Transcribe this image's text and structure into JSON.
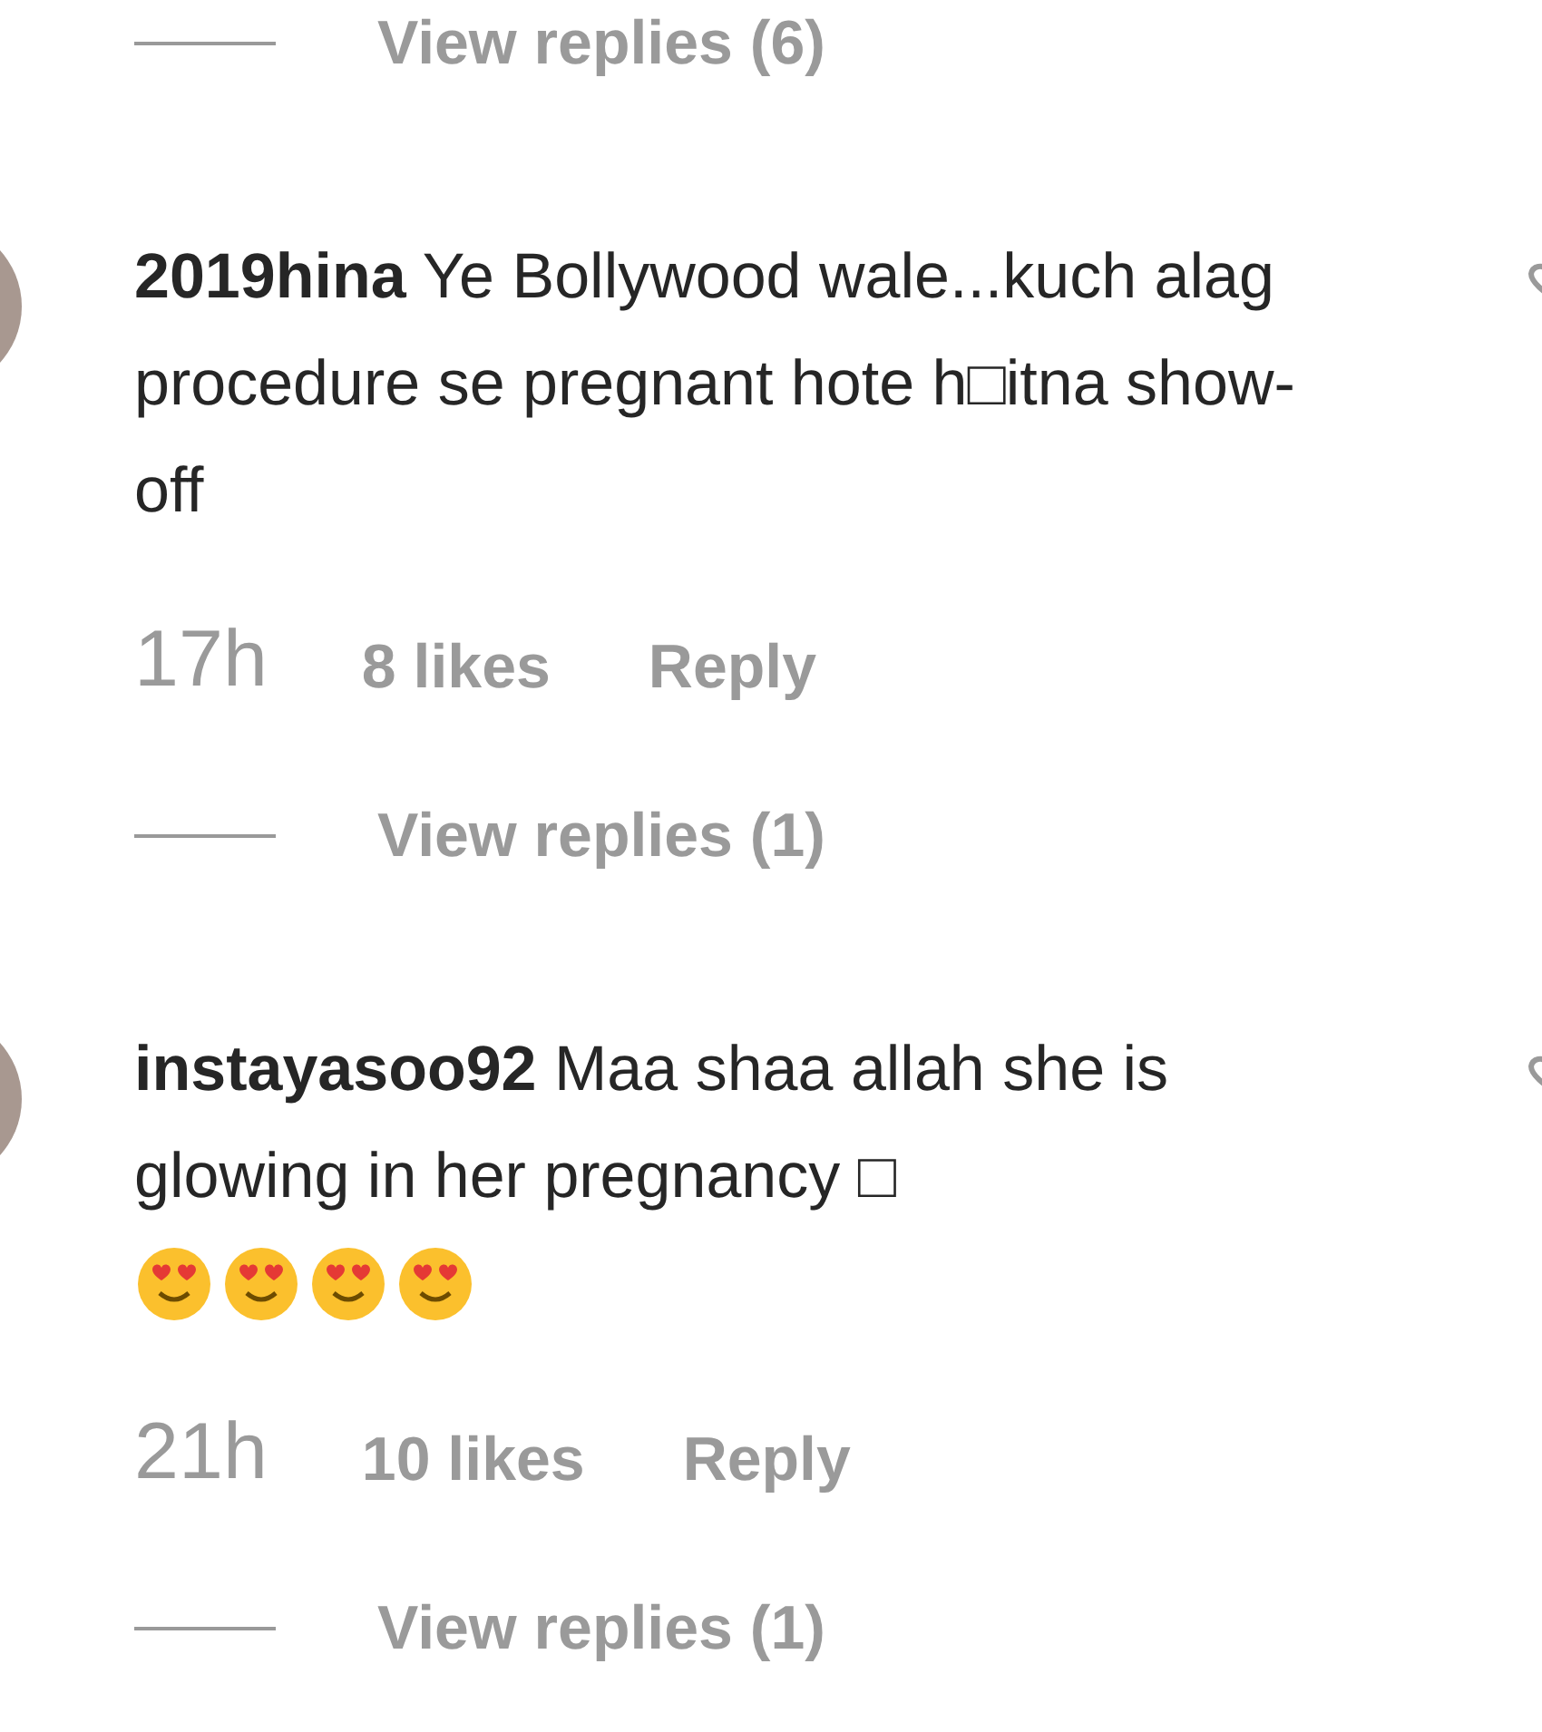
{
  "items": [
    {
      "kind": "view_replies",
      "label": "View replies (6)"
    },
    {
      "kind": "comment",
      "username": "2019hina",
      "text": "Ye Bollywood wale...kuch alag procedure se pregnant hote h□itna show-off",
      "time": "17h",
      "likes": "8 likes",
      "reply": "Reply"
    },
    {
      "kind": "view_replies",
      "label": "View replies (1)"
    },
    {
      "kind": "comment",
      "username": "instayasoo92",
      "text": "Maa shaa allah she is glowing in her pregnancy □",
      "emojis": [
        {
          "kind": "heart-eyes"
        },
        {
          "kind": "heart-eyes"
        },
        {
          "kind": "heart-eyes"
        },
        {
          "kind": "heart-eyes"
        }
      ],
      "time": "21h",
      "likes": "10 likes",
      "reply": "Reply"
    },
    {
      "kind": "view_replies",
      "label": "View replies (1)"
    }
  ]
}
